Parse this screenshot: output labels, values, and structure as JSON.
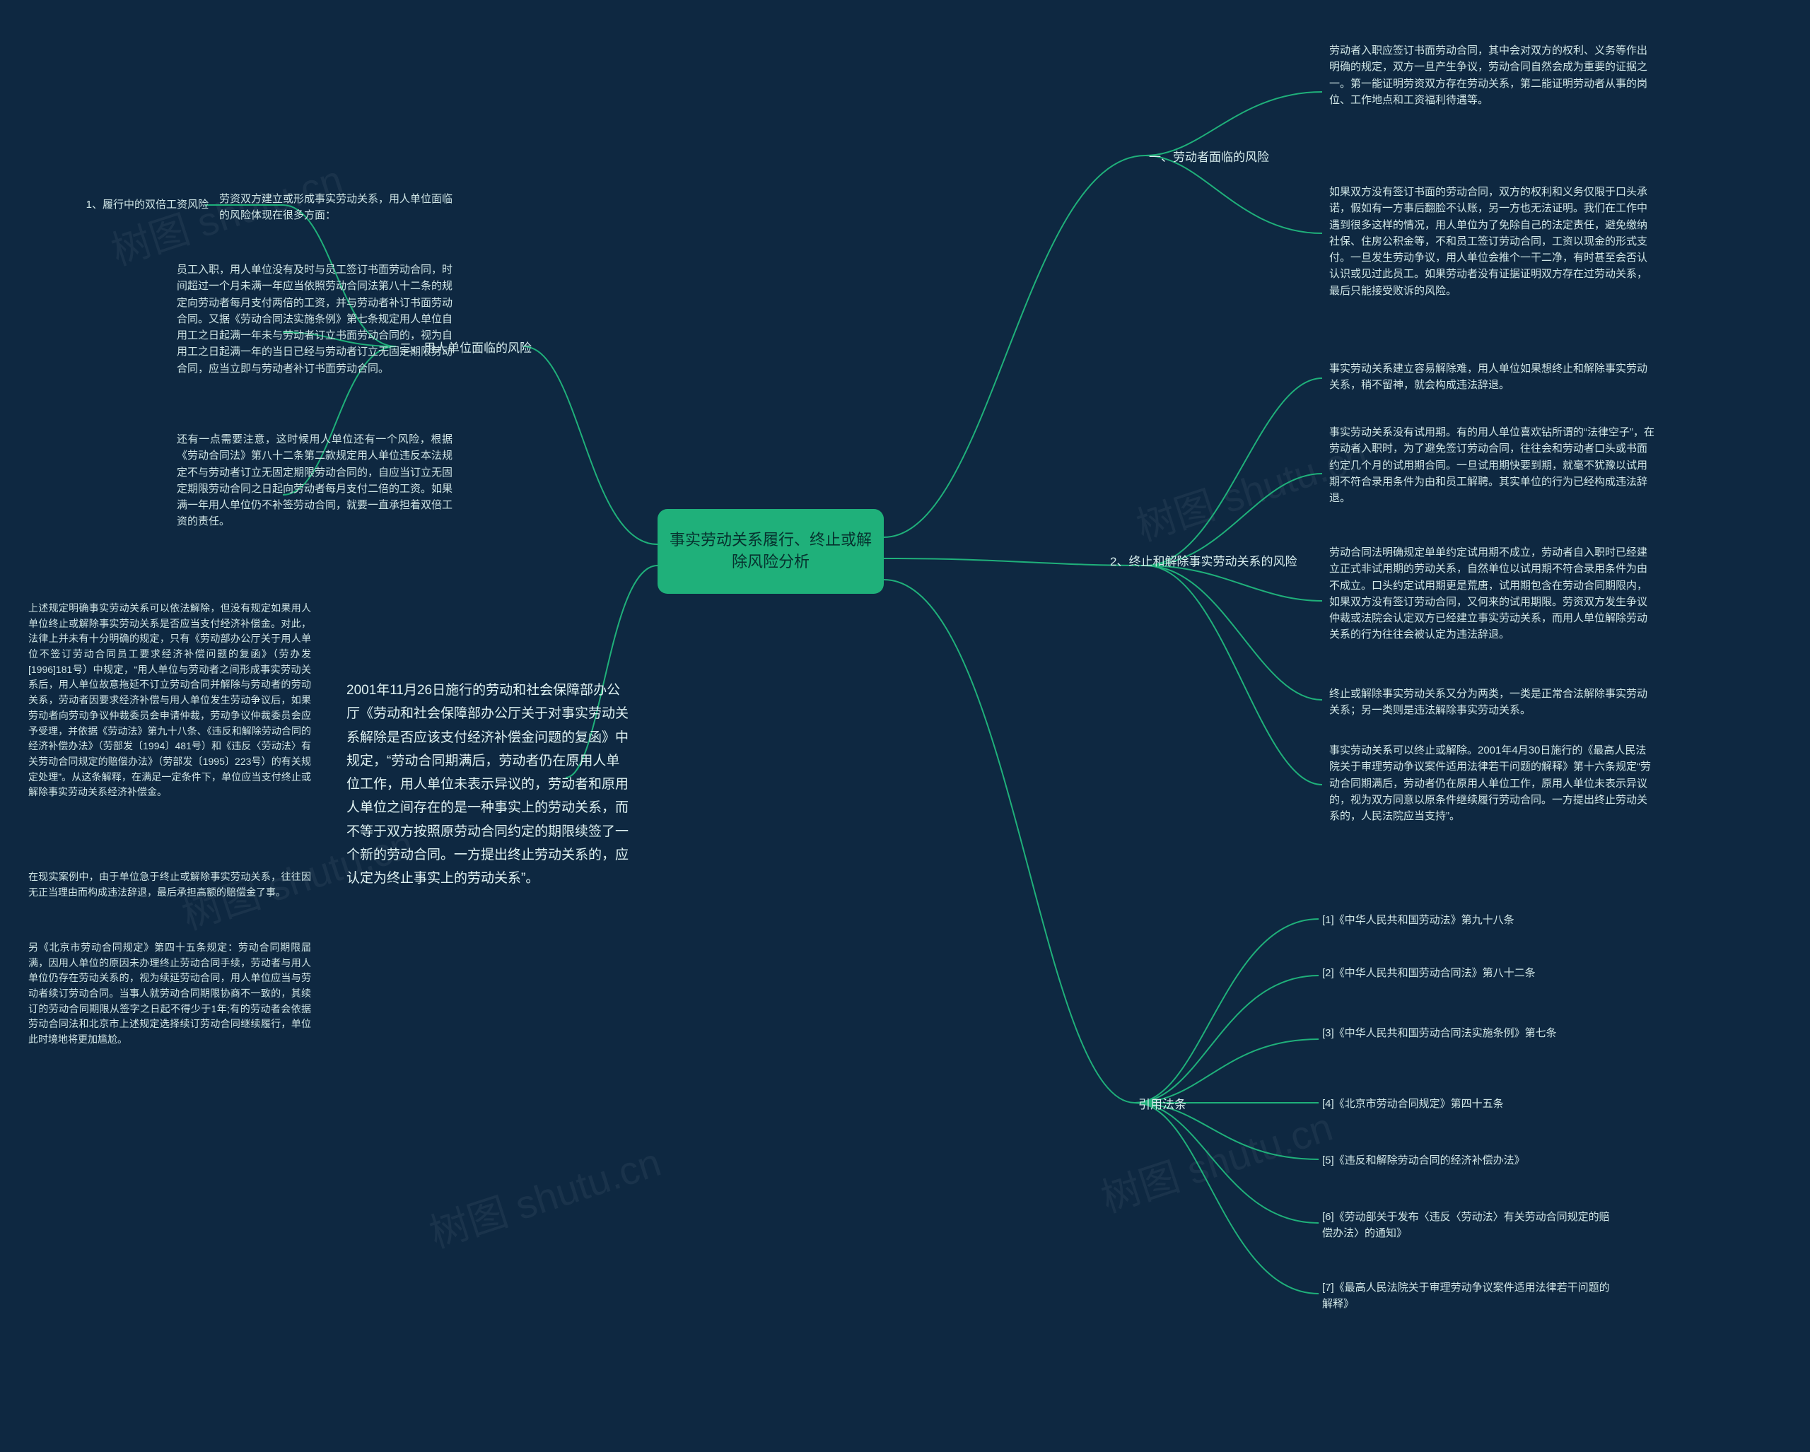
{
  "center": "事实劳动关系履行、终止或解除风险分析",
  "watermark": "树图 shutu.cn",
  "right": {
    "b1": {
      "title": "一、劳动者面临的风险",
      "p1": "劳动者入职应签订书面劳动合同，其中会对双方的权利、义务等作出明确的规定，双方一旦产生争议，劳动合同自然会成为重要的证据之一。第一能证明劳资双方存在劳动关系，第二能证明劳动者从事的岗位、工作地点和工资福利待遇等。",
      "p2": "如果双方没有签订书面的劳动合同，双方的权利和义务仅限于口头承诺，假如有一方事后翻脸不认账，另一方也无法证明。我们在工作中遇到很多这样的情况，用人单位为了免除自己的法定责任，避免缴纳社保、住房公积金等，不和员工签订劳动合同，工资以现金的形式支付。一旦发生劳动争议，用人单位会推个一干二净，有时甚至会否认认识或见过此员工。如果劳动者没有证据证明双方存在过劳动关系，最后只能接受败诉的风险。"
    },
    "b2": {
      "title": "2、终止和解除事实劳动关系的风险",
      "p1": "事实劳动关系建立容易解除难，用人单位如果想终止和解除事实劳动关系，稍不留神，就会构成违法辞退。",
      "p2": "事实劳动关系没有试用期。有的用人单位喜欢钻所谓的“法律空子”，在劳动者入职时，为了避免签订劳动合同，往往会和劳动者口头或书面约定几个月的试用期合同。一旦试用期快要到期，就毫不犹豫以试用期不符合录用条件为由和员工解聘。其实单位的行为已经构成违法辞退。",
      "p3": "劳动合同法明确规定单单约定试用期不成立，劳动者自入职时已经建立正式非试用期的劳动关系，自然单位以试用期不符合录用条件为由不成立。口头约定试用期更是荒唐，试用期包含在劳动合同期限内，如果双方没有签订劳动合同，又何来的试用期限。劳资双方发生争议仲裁或法院会认定双方已经建立事实劳动关系，而用人单位解除劳动关系的行为往往会被认定为违法辞退。",
      "p4": "终止或解除事实劳动关系又分为两类，一类是正常合法解除事实劳动关系；另一类则是违法解除事实劳动关系。",
      "p5": "事实劳动关系可以终止或解除。2001年4月30日施行的《最高人民法院关于审理劳动争议案件适用法律若干问题的解释》第十六条规定“劳动合同期满后，劳动者仍在原用人单位工作，原用人单位未表示异议的，视为双方同意以原条件继续履行劳动合同。一方提出终止劳动关系的，人民法院应当支持”。"
    },
    "ref": {
      "title": "引用法条",
      "items": [
        "[1]《中华人民共和国劳动法》第九十八条",
        "[2]《中华人民共和国劳动合同法》第八十二条",
        "[3]《中华人民共和国劳动合同法实施条例》第七条",
        "[4]《北京市劳动合同规定》第四十五条",
        "[5]《违反和解除劳动合同的经济补偿办法》",
        "[6]《劳动部关于发布〈违反〈劳动法〉有关劳动合同规定的赔偿办法〉的通知》",
        "[7]《最高人民法院关于审理劳动争议案件适用法律若干问题的解释》"
      ]
    }
  },
  "left": {
    "b3": {
      "title": "二、用人单位面临的风险",
      "sub1": "1、履行中的双倍工资风险",
      "s1": "劳资双方建立或形成事实劳动关系，用人单位面临的风险体现在很多方面：",
      "p2": "员工入职，用人单位没有及时与员工签订书面劳动合同，时间超过一个月未满一年应当依照劳动合同法第八十二条的规定向劳动者每月支付两倍的工资，并与劳动者补订书面劳动合同。又据《劳动合同法实施条例》第七条规定用人单位自用工之日起满一年未与劳动者订立书面劳动合同的，视为自用工之日起满一年的当日已经与劳动者订立无固定期限劳动合同，应当立即与劳动者补订书面劳动合同。",
      "p3": "还有一点需要注意，这时候用人单位还有一个风险，根据《劳动合同法》第八十二条第二款规定用人单位违反本法规定不与劳动者订立无固定期限劳动合同的，自应当订立无固定期限劳动合同之日起向劳动者每月支付二倍的工资。如果满一年用人单位仍不补签劳动合同，就要一直承担着双倍工资的责任。"
    },
    "col": {
      "p1": "上述规定明确事实劳动关系可以依法解除，但没有规定如果用人单位终止或解除事实劳动关系是否应当支付经济补偿金。对此，法律上并未有十分明确的规定，只有《劳动部办公厅关于用人单位不签订劳动合同员工要求经济补偿问题的复函》（劳办发[1996]181号）中规定，“用人单位与劳动者之间形成事实劳动关系后，用人单位故意拖延不订立劳动合同并解除与劳动者的劳动关系，劳动者因要求经济补偿与用人单位发生劳动争议后，如果劳动者向劳动争议仲裁委员会申请仲裁，劳动争议仲裁委员会应予受理，并依据《劳动法》第九十八条、《违反和解除劳动合同的经济补偿办法》（劳部发〔1994〕481号）和《违反〈劳动法〉有关劳动合同规定的赔偿办法》（劳部发〔1995〕223号）的有关规定处理”。从这条解释，在满足一定条件下，单位应当支付终止或解除事实劳动关系经济补偿金。",
      "p2": "在现实案例中，由于单位急于终止或解除事实劳动关系，往往因无正当理由而构成违法辞退，最后承担高额的赔偿金了事。",
      "p3": "另《北京市劳动合同规定》第四十五条规定：劳动合同期限届满，因用人单位的原因未办理终止劳动合同手续，劳动者与用人单位仍存在劳动关系的，视为续延劳动合同，用人单位应当与劳动者续订劳动合同。当事人就劳动合同期限协商不一致的，其续订的劳动合同期限从签字之日起不得少于1年;有的劳动者会依据劳动合同法和北京市上述规定选择续订劳动合同继续履行，单位此时境地将更加尴尬。"
    },
    "bigquote": "2001年11月26日施行的劳动和社会保障部办公厅《劳动和社会保障部办公厅关于对事实劳动关系解除是否应该支付经济补偿金问题的复函》中规定，“劳动合同期满后，劳动者仍在原用人单位工作，用人单位未表示异议的，劳动者和原用人单位之间存在的是一种事实上的劳动关系，而不等于双方按照原劳动合同约定的期限续签了一个新的劳动合同。一方提出终止劳动关系的，应认定为终止事实上的劳动关系”。"
  }
}
